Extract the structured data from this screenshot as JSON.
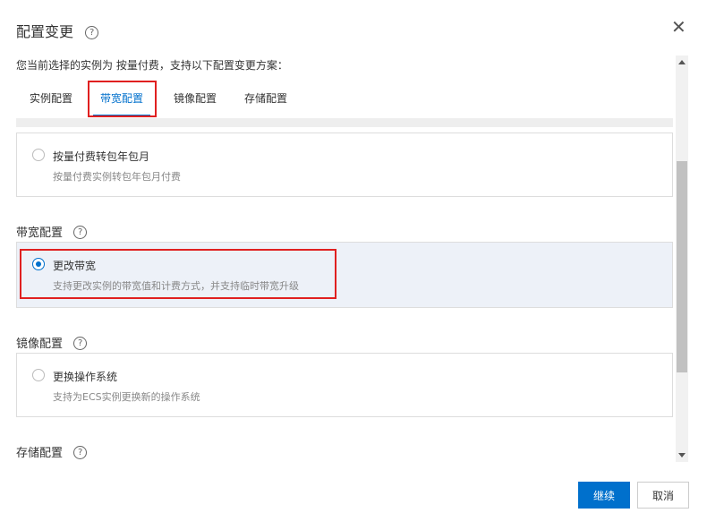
{
  "dialog": {
    "title": "配置变更",
    "help_glyph": "?",
    "close_glyph": "✕",
    "subtitle": "您当前选择的实例为 按量付费，支持以下配置变更方案："
  },
  "tabs": [
    {
      "label": "实例配置",
      "active": false
    },
    {
      "label": "带宽配置",
      "active": true
    },
    {
      "label": "镜像配置",
      "active": false
    },
    {
      "label": "存储配置",
      "active": false
    }
  ],
  "cards": {
    "billing": {
      "label": "按量付费转包年包月",
      "desc": "按量付费实例转包年包月付费",
      "selected": false
    },
    "bandwidth": {
      "label": "更改带宽",
      "desc": "支持更改实例的带宽值和计费方式，并支持临时带宽升级",
      "selected": true
    },
    "image": {
      "label": "更换操作系统",
      "desc": "支持为ECS实例更换新的操作系统",
      "selected": false
    }
  },
  "sections": {
    "bandwidth": "带宽配置",
    "image": "镜像配置",
    "storage": "存储配置"
  },
  "footer": {
    "continue_label": "继续",
    "cancel_label": "取消"
  },
  "colors": {
    "accent": "#0070cc",
    "highlight_border": "#e02020",
    "selected_card_bg": "#edf1f8"
  },
  "icons": [
    "help-icon",
    "close-icon",
    "radio-icon",
    "scroll-up-icon",
    "scroll-down-icon"
  ]
}
